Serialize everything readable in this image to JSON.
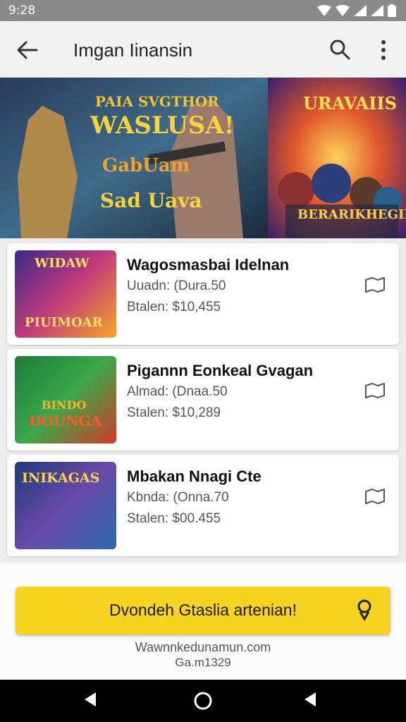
{
  "status": {
    "time": "9:28"
  },
  "appbar": {
    "title": "Imgan Iinansin"
  },
  "banner": {
    "left_art": {
      "heading1": "PAIA SVGTHOR",
      "heading2": "WASLUSA!",
      "sub1": "GabUam",
      "sub2": "Sad Uava"
    },
    "right_art": {
      "heading": "URAVAIIS",
      "footer": "BERARIKHEGIN"
    }
  },
  "cards": [
    {
      "name": "Wagosmasbai Idelnan",
      "line1": "Uuadn: (Dura.50",
      "line2": "Btalen: $10,455",
      "art_title": "PIUIMOAR",
      "art_top": "WIDAW"
    },
    {
      "name": "Pigannn Eonkeal Gvagan",
      "line1": "Almad: (Dnaa.50",
      "line2": "Stalen: $10,289",
      "art_title": "DOUNGA",
      "art_top": "BINDO"
    },
    {
      "name": "Mbakan Nnagi Cte",
      "line1": "Kbnda: (Onna.70",
      "line2": "Stalen: $00.455",
      "art_title": "INIKAGAS",
      "art_top": ""
    }
  ],
  "cta": {
    "label": "Dvondeh Gtaslia artenian!"
  },
  "footer": {
    "line1": "Wawnnkedunamun.com",
    "line2": "Ga.m1329"
  },
  "colors": {
    "accent": "#f7d421",
    "navbar": "#000000",
    "statusbar": "#8a8a8a"
  }
}
